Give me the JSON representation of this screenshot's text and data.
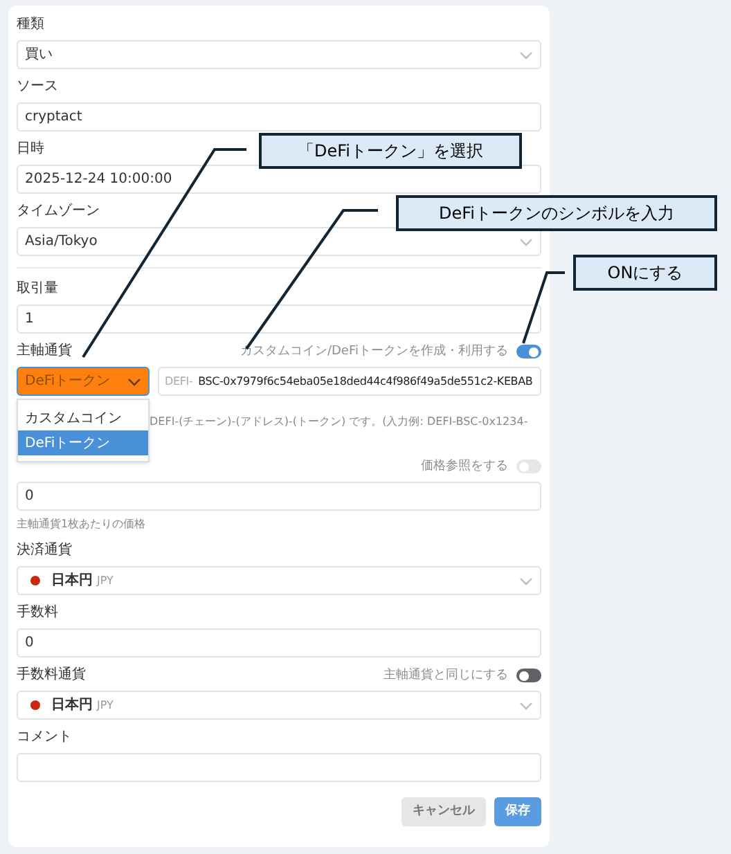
{
  "sections": [
    [
      {
        "kind": "select",
        "label": "種類",
        "value": "買い"
      },
      {
        "kind": "input",
        "label": "ソース",
        "value": "cryptact"
      },
      {
        "kind": "input",
        "label": "日時",
        "value": "2025-12-24 10:00:00"
      },
      {
        "kind": "select",
        "label": "タイムゾーン",
        "value": "Asia/Tokyo"
      }
    ],
    [
      {
        "kind": "input",
        "label": "取引量",
        "value": "1"
      },
      {
        "kind": "token",
        "label": "主軸通貨",
        "toggle": {
          "label": "カスタムコイン/DeFiトークンを作成・利用する",
          "on": true,
          "disabled": false
        },
        "type_value": "DeFiトークン",
        "prefix": "DEFI-",
        "value": "BSC-0x7979f6c54eba05e18ded44c4f986f49a5de551c2-KEBAB",
        "help": "DEFI-(チェーン)-(アドレス)-(トークン) です。(入力例: DEFI-BSC-0x1234-",
        "options": [
          {
            "label": "カスタムコイン",
            "selected": false
          },
          {
            "label": "DeFiトークン",
            "selected": true
          }
        ]
      },
      {
        "kind": "input",
        "toggle": {
          "label": "価格参照をする",
          "on": false,
          "disabled": true
        },
        "value": "0",
        "help": "主軸通貨1枚あたりの価格"
      },
      {
        "kind": "currency",
        "label": "決済通貨",
        "name": "日本円",
        "code": "JPY",
        "color": "#c8290e"
      },
      {
        "kind": "input",
        "label": "手数料",
        "value": "0"
      },
      {
        "kind": "currency",
        "label": "手数料通貨",
        "toggle": {
          "label": "主軸通貨と同じにする",
          "on": false,
          "disabled": false
        },
        "name": "日本円",
        "code": "JPY",
        "color": "#c8290e"
      },
      {
        "kind": "textarea",
        "label": "コメント"
      }
    ]
  ],
  "buttons": [
    {
      "label": "キャンセル",
      "kind": "secondary"
    },
    {
      "label": "保存",
      "kind": "primary"
    }
  ],
  "callouts": [
    {
      "text": "「DeFiトークン」を選択"
    },
    {
      "text": "DeFiトークンのシンボルを入力"
    },
    {
      "text": "ONにする"
    }
  ]
}
